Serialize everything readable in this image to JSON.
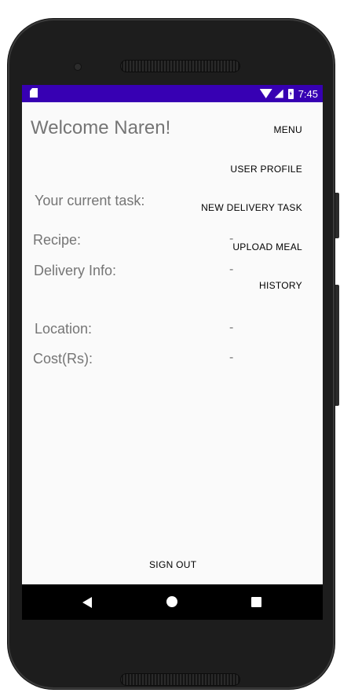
{
  "status_bar": {
    "time": "7:45"
  },
  "header": {
    "welcome": "Welcome Naren!"
  },
  "menu": {
    "menu_label": "MENU",
    "user_profile_label": "USER PROFILE",
    "new_delivery_task_label": "NEW DELIVERY TASK",
    "upload_meal_label": "UPLOAD MEAL",
    "history_label": "HISTORY"
  },
  "task": {
    "current_task_label": "Your current task:",
    "recipe_label": "Recipe:",
    "recipe_value": "-",
    "delivery_info_label": "Delivery Info:",
    "delivery_info_value": "-",
    "location_label": "Location:",
    "location_value": "-",
    "cost_label": "Cost(Rs):",
    "cost_value": "-"
  },
  "footer": {
    "sign_out_label": "SIGN OUT"
  },
  "colors": {
    "status_bar": "#3700b3",
    "screen_bg": "#fafafa",
    "text_gray": "#757575"
  }
}
